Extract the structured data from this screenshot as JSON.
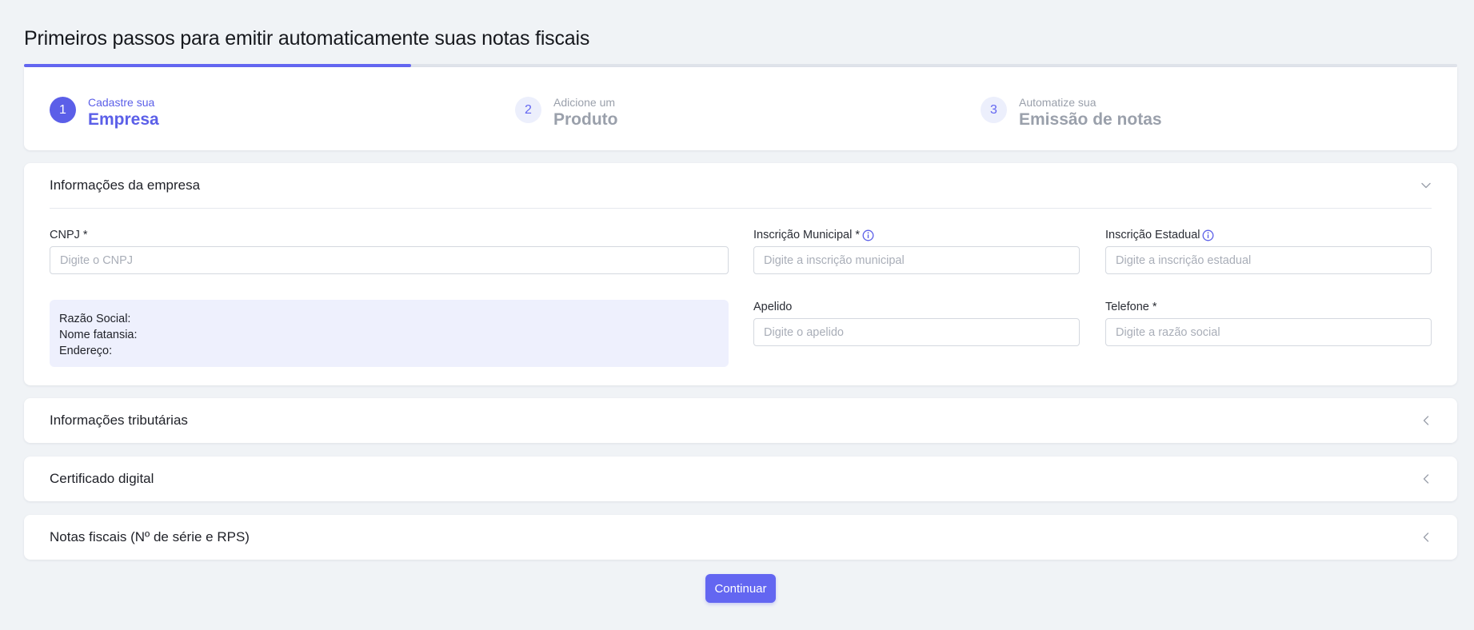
{
  "page": {
    "title": "Primeiros passos para emitir automaticamente suas notas fiscais",
    "progress_fraction": 0.27
  },
  "steps": [
    {
      "number": "1",
      "small": "Cadastre sua",
      "big": "Empresa",
      "state": "active"
    },
    {
      "number": "2",
      "small": "Adicione um",
      "big": "Produto",
      "state": "inactive"
    },
    {
      "number": "3",
      "small": "Automatize sua",
      "big": "Emissão de notas",
      "state": "inactive"
    }
  ],
  "company_section": {
    "title": "Informações da empresa",
    "cnpj": {
      "label": "CNPJ *",
      "placeholder": "Digite o CNPJ",
      "value": ""
    },
    "inscricao_municipal": {
      "label": "Inscrição Municipal *",
      "placeholder": "Digite a inscrição municipal",
      "value": ""
    },
    "inscricao_estadual": {
      "label": "Inscrição Estadual",
      "placeholder": "Digite a inscrição estadual",
      "value": ""
    },
    "apelido": {
      "label": "Apelido",
      "placeholder": "Digite o apelido",
      "value": ""
    },
    "telefone": {
      "label": "Telefone *",
      "placeholder": "Digite a razão social",
      "value": ""
    },
    "info_box": {
      "razao_social": "Razão Social:",
      "nome_fantasia": "Nome fatansia:",
      "endereco": "Endereço:"
    }
  },
  "collapsed_sections": [
    {
      "title": "Informações tributárias"
    },
    {
      "title": "Certificado digital"
    },
    {
      "title": "Notas fiscais (Nº de série e RPS)"
    }
  ],
  "actions": {
    "continue_label": "Continuar"
  },
  "colors": {
    "accent": "#6366f1",
    "background": "#f0f3f6",
    "info_box": "#eef0fd",
    "inactive_text": "#9aa0ab"
  },
  "icons": {
    "expanded_chevron": "chevron-down-icon",
    "collapsed_chevron": "chevron-left-icon",
    "info": "info-icon"
  }
}
